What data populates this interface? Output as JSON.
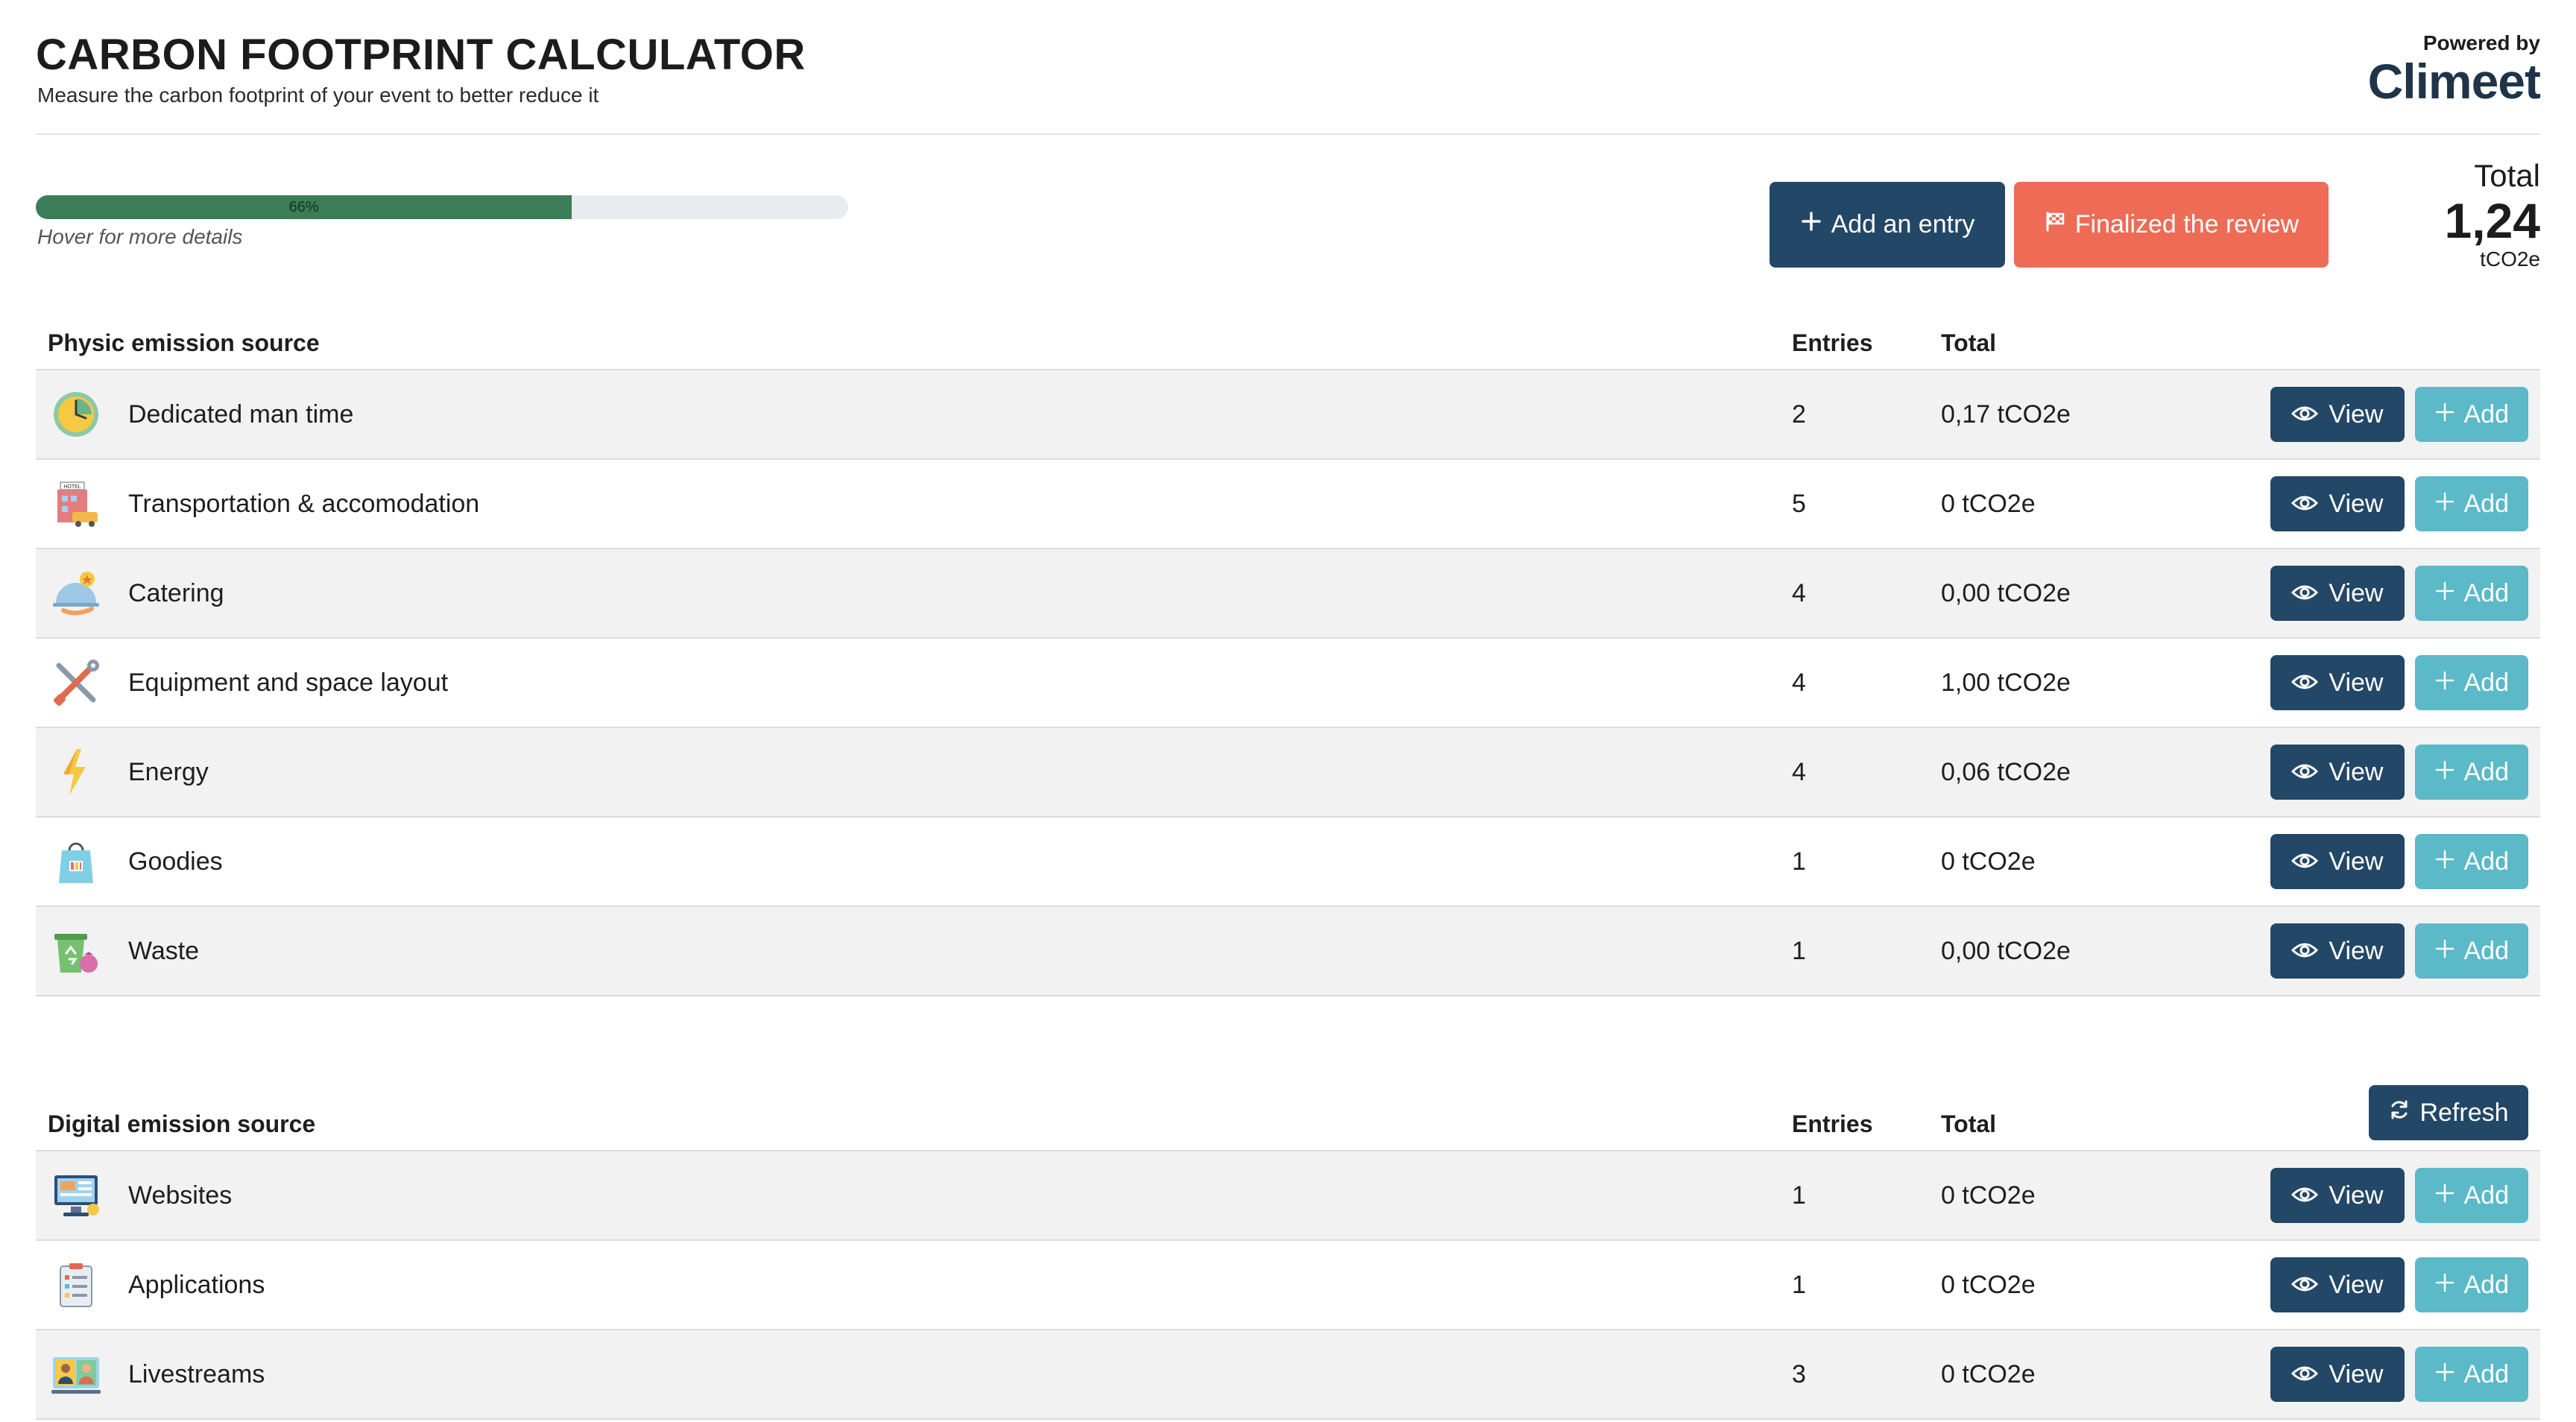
{
  "header": {
    "title": "CARBON FOOTPRINT CALCULATOR",
    "subtitle": "Measure the carbon footprint of your event to better reduce it",
    "powered_by": "Powered by",
    "brand": "Climeet"
  },
  "progress": {
    "percent": 66,
    "label": "66%",
    "hint": "Hover for more details"
  },
  "actions": {
    "add_entry_label": "Add an entry",
    "finalize_label": "Finalized the review"
  },
  "total": {
    "label": "Total",
    "value": "1,24",
    "unit": "tCO2e"
  },
  "physic": {
    "header_name": "Physic emission source",
    "header_entries": "Entries",
    "header_total": "Total",
    "rows": [
      {
        "name": "Dedicated man time",
        "entries": "2",
        "total": "0,17 tCO2e",
        "icon": "clock-icon"
      },
      {
        "name": "Transportation & accomodation",
        "entries": "5",
        "total": "0 tCO2e",
        "icon": "hotel-icon"
      },
      {
        "name": "Catering",
        "entries": "4",
        "total": "0,00 tCO2e",
        "icon": "cloche-icon"
      },
      {
        "name": "Equipment and space layout",
        "entries": "4",
        "total": "1,00 tCO2e",
        "icon": "tools-icon"
      },
      {
        "name": "Energy",
        "entries": "4",
        "total": "0,06 tCO2e",
        "icon": "lightning-icon"
      },
      {
        "name": "Goodies",
        "entries": "1",
        "total": "0 tCO2e",
        "icon": "shopping-bag-icon"
      },
      {
        "name": "Waste",
        "entries": "1",
        "total": "0,00 tCO2e",
        "icon": "recycle-bin-icon"
      }
    ]
  },
  "digital": {
    "header_name": "Digital emission source",
    "header_entries": "Entries",
    "header_total": "Total",
    "refresh_label": "Refresh",
    "rows": [
      {
        "name": "Websites",
        "entries": "1",
        "total": "0 tCO2e",
        "icon": "website-icon"
      },
      {
        "name": "Applications",
        "entries": "1",
        "total": "0 tCO2e",
        "icon": "clipboard-app-icon"
      },
      {
        "name": "Livestreams",
        "entries": "3",
        "total": "0 tCO2e",
        "icon": "video-call-icon"
      }
    ]
  },
  "row_actions": {
    "view_label": "View",
    "add_label": "Add"
  },
  "colors": {
    "primary": "#234766",
    "accent_add": "#5bb9c8",
    "finalize": "#ee6b56",
    "progress": "#3a7d56"
  }
}
